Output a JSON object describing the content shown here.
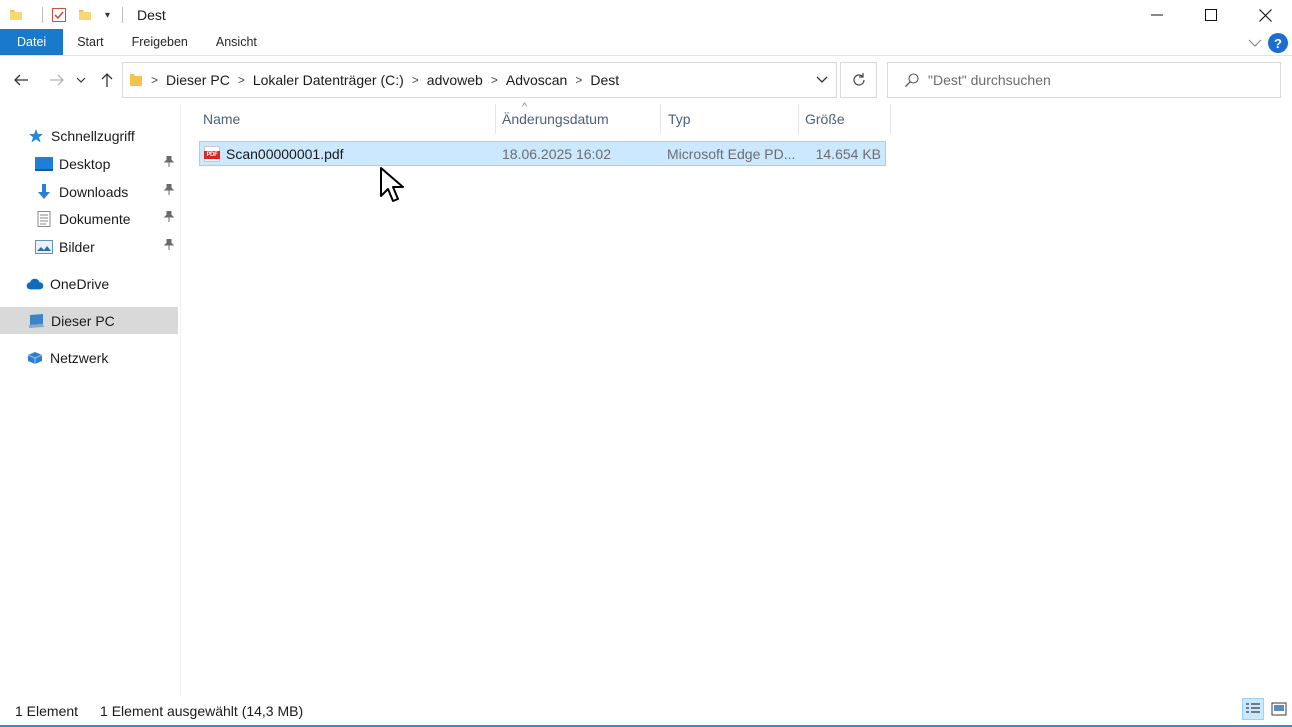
{
  "window": {
    "title": "Dest",
    "qat_dropdown_glyph": "▾",
    "controls": [
      "minimize-icon",
      "maximize-icon",
      "close-icon"
    ]
  },
  "ribbon": {
    "tabs": [
      {
        "label": "Datei",
        "active": true
      },
      {
        "label": "Start"
      },
      {
        "label": "Freigeben"
      },
      {
        "label": "Ansicht"
      }
    ],
    "help_label": "?"
  },
  "address": {
    "breadcrumbs": [
      "Dieser PC",
      "Lokaler Datenträger (C:)",
      "advoweb",
      "Advoscan",
      "Dest"
    ],
    "separator": ">"
  },
  "search": {
    "placeholder": "\"Dest\" durchsuchen"
  },
  "nav": {
    "quick_access": {
      "label": "Schnellzugriff",
      "icon": "star-icon"
    },
    "pinned": [
      {
        "label": "Desktop",
        "icon": "desktop-icon"
      },
      {
        "label": "Downloads",
        "icon": "download-arrow-icon"
      },
      {
        "label": "Dokumente",
        "icon": "document-icon"
      },
      {
        "label": "Bilder",
        "icon": "pictures-icon"
      }
    ],
    "onedrive": {
      "label": "OneDrive",
      "icon": "cloud-icon"
    },
    "this_pc": {
      "label": "Dieser PC",
      "icon": "computer-icon",
      "selected": true
    },
    "network": {
      "label": "Netzwerk",
      "icon": "network-icon"
    }
  },
  "columns": {
    "name": "Name",
    "date": "Änderungsdatum",
    "type": "Typ",
    "size": "Größe",
    "sort_glyph": "^"
  },
  "files": [
    {
      "name": "Scan00000001.pdf",
      "date": "18.06.2025 16:02",
      "type": "Microsoft Edge PD...",
      "size": "14.654 KB",
      "icon_label": "PDF",
      "selected": true
    }
  ],
  "status": {
    "count": "1 Element",
    "selection": "1 Element ausgewählt (14,3 MB)"
  },
  "colors": {
    "file_tab": "#1979ca",
    "selection_fill": "#cce8ff",
    "selection_border": "#99d1ff",
    "header_text": "#4c607a",
    "help_blue": "#1c6dd0"
  }
}
